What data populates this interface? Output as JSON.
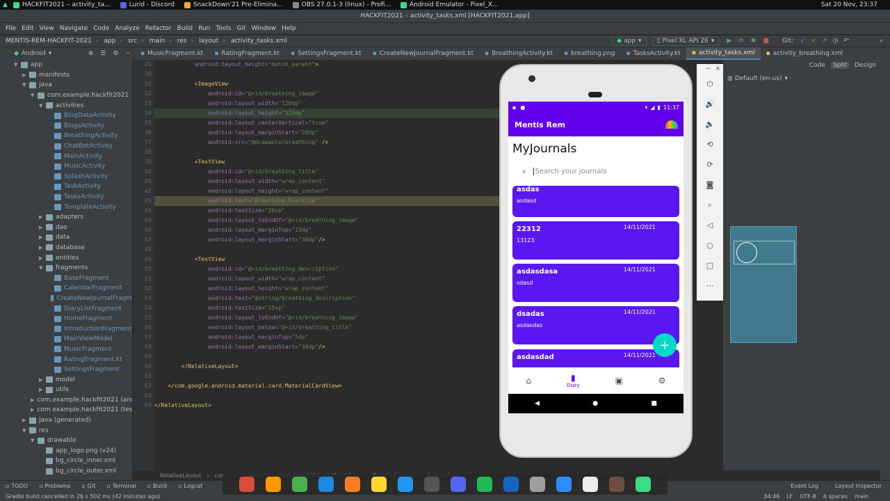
{
  "topbar": {
    "apps": [
      {
        "label": "HACKFIT2021 – activity_ta...",
        "color": "#3ddc84"
      },
      {
        "label": "Lurid - Discord",
        "color": "#5865f2"
      },
      {
        "label": "SnackDown'21 Pre-Elimina...",
        "color": "#f0a830"
      },
      {
        "label": "OBS 27.0.1-3 (linux) - Profi...",
        "color": "#888888"
      },
      {
        "label": "Android Emulator - Pixel_X...",
        "color": "#3ddc84"
      }
    ],
    "datetime": "Sat 20 Nov, 23:37"
  },
  "window_title": "HACKFIT2021 – activity_tasks.xml [HACKFIT2021.app]",
  "menu": [
    "File",
    "Edit",
    "View",
    "Navigate",
    "Code",
    "Analyze",
    "Refactor",
    "Build",
    "Run",
    "Tools",
    "Git",
    "Window",
    "Help"
  ],
  "breadcrumbs": [
    "MENTIS-REM-HACKFIT-2021",
    "app",
    "src",
    "main",
    "res",
    "layout",
    "activity_tasks.xml"
  ],
  "run_config": "app",
  "device": "Pixel XL API 26",
  "git_label": "Git:",
  "project_view": "Android",
  "tabs": [
    {
      "label": "MusicFragment.kt",
      "active": false
    },
    {
      "label": "RatingFragment.kt",
      "active": false
    },
    {
      "label": "SettingsFragment.kt",
      "active": false
    },
    {
      "label": "CreateNewJournalFragment.kt",
      "active": false
    },
    {
      "label": "BreathingActivity.kt",
      "active": false
    },
    {
      "label": "breathing.png",
      "active": false
    },
    {
      "label": "TasksActivity.kt",
      "active": false
    },
    {
      "label": "activity_tasks.xml",
      "active": true
    },
    {
      "label": "activity_breathing.xml",
      "active": false
    }
  ],
  "tree": [
    {
      "label": "app",
      "depth": 0,
      "arrow": "▼",
      "kt": false
    },
    {
      "label": "manifests",
      "depth": 1,
      "arrow": "▶",
      "kt": false
    },
    {
      "label": "java",
      "depth": 1,
      "arrow": "▼",
      "kt": false
    },
    {
      "label": "com.example.hackfit2021",
      "depth": 2,
      "arrow": "▼",
      "kt": false
    },
    {
      "label": "activities",
      "depth": 3,
      "arrow": "▼",
      "kt": false
    },
    {
      "label": "BlogDataActivity",
      "depth": 4,
      "arrow": "",
      "kt": true
    },
    {
      "label": "BlogsActivity",
      "depth": 4,
      "arrow": "",
      "kt": true
    },
    {
      "label": "BreathingActivity",
      "depth": 4,
      "arrow": "",
      "kt": true
    },
    {
      "label": "ChatBotActivity",
      "depth": 4,
      "arrow": "",
      "kt": true
    },
    {
      "label": "MainActivity",
      "depth": 4,
      "arrow": "",
      "kt": true
    },
    {
      "label": "MusicActivity",
      "depth": 4,
      "arrow": "",
      "kt": true
    },
    {
      "label": "SplashActivity",
      "depth": 4,
      "arrow": "",
      "kt": true
    },
    {
      "label": "TaskActivity",
      "depth": 4,
      "arrow": "",
      "kt": true
    },
    {
      "label": "TasksActivity",
      "depth": 4,
      "arrow": "",
      "kt": true
    },
    {
      "label": "TemplateActivity",
      "depth": 4,
      "arrow": "",
      "kt": true
    },
    {
      "label": "adapters",
      "depth": 3,
      "arrow": "▶",
      "kt": false
    },
    {
      "label": "dao",
      "depth": 3,
      "arrow": "▶",
      "kt": false
    },
    {
      "label": "data",
      "depth": 3,
      "arrow": "▶",
      "kt": false
    },
    {
      "label": "database",
      "depth": 3,
      "arrow": "▶",
      "kt": false
    },
    {
      "label": "entities",
      "depth": 3,
      "arrow": "▶",
      "kt": false
    },
    {
      "label": "fragments",
      "depth": 3,
      "arrow": "▼",
      "kt": false
    },
    {
      "label": "BaseFragment",
      "depth": 4,
      "arrow": "",
      "kt": true
    },
    {
      "label": "CalendarFragment",
      "depth": 4,
      "arrow": "",
      "kt": true
    },
    {
      "label": "CreateNewJournalFragm",
      "depth": 4,
      "arrow": "",
      "kt": true
    },
    {
      "label": "DiaryListFragment",
      "depth": 4,
      "arrow": "",
      "kt": true
    },
    {
      "label": "HomeFragment",
      "depth": 4,
      "arrow": "",
      "kt": true
    },
    {
      "label": "IntroductionFragment",
      "depth": 4,
      "arrow": "",
      "kt": true
    },
    {
      "label": "MainViewModel",
      "depth": 4,
      "arrow": "",
      "kt": true
    },
    {
      "label": "MusicFragment",
      "depth": 4,
      "arrow": "",
      "kt": true
    },
    {
      "label": "RatingFragment.kt",
      "depth": 4,
      "arrow": "",
      "kt": true
    },
    {
      "label": "SettingsFragment",
      "depth": 4,
      "arrow": "",
      "kt": true
    },
    {
      "label": "model",
      "depth": 3,
      "arrow": "▶",
      "kt": false
    },
    {
      "label": "utils",
      "depth": 3,
      "arrow": "▶",
      "kt": false
    },
    {
      "label": "com.example.hackfit2021 (and",
      "depth": 2,
      "arrow": "▶",
      "kt": false
    },
    {
      "label": "com.example.hackfit2021 (test",
      "depth": 2,
      "arrow": "▶",
      "kt": false
    },
    {
      "label": "java (generated)",
      "depth": 1,
      "arrow": "▶",
      "kt": false
    },
    {
      "label": "res",
      "depth": 1,
      "arrow": "▼",
      "kt": false
    },
    {
      "label": "drawable",
      "depth": 2,
      "arrow": "▼",
      "kt": false
    },
    {
      "label": "app_logo.png (v24)",
      "depth": 3,
      "arrow": "",
      "kt": false
    },
    {
      "label": "bg_circle_inner.xml",
      "depth": 3,
      "arrow": "",
      "kt": false
    },
    {
      "label": "bg_circle_outer.xml",
      "depth": 3,
      "arrow": "",
      "kt": false
    }
  ],
  "line_numbers": [
    "29",
    "30",
    "31",
    "32",
    "33",
    "34",
    "35",
    "36",
    "37",
    "38",
    "39",
    "40",
    "41",
    "42",
    "43",
    "44",
    "45",
    "46",
    "47",
    "48",
    "49",
    "50",
    "51",
    "52",
    "53",
    "54",
    "55",
    "56",
    "57",
    "58",
    "59",
    "60",
    "61",
    "62",
    "63",
    "64"
  ],
  "code_lines": [
    "            android:layout_height=\"match_parent\">",
    "",
    "            <ImageView",
    "                android:id=\"@+id/breathing_image\"",
    "                android:layout_width=\"120dp\"",
    "                android:layout_height=\"120dp\"",
    "                android:layout_centerVertical=\"true\"",
    "                android:layout_marginStart=\"20dp\"",
    "                android:src=\"@drawable/breathing\" />",
    "",
    "            <TextView",
    "                android:id=\"@+id/breathing_title\"",
    "                android:layout_width=\"wrap_content\"",
    "                android:layout_height=\"wrap_content\"",
    "                android:text=\"Breathing Exercise\"",
    "                android:textSize=\"20sp\"",
    "                android:layout_toEndOf=\"@+id/breathing_image\"",
    "                android:layout_marginTop=\"15dp\"",
    "                android:layout_marginStart=\"30dp\"/>",
    "",
    "            <TextView",
    "                android:id=\"@+id/breathing_description\"",
    "                android:layout_width=\"wrap_content\"",
    "                android:layout_height=\"wrap_content\"",
    "                android:text=\"@string/breathing_description\"",
    "                android:textSize=\"15sp\"",
    "                android:layout_toEndOf=\"@+id/breathing_image\"",
    "                android:layout_below=\"@+id/breathing_title\"",
    "                android:layout_marginTop=\"5dp\"",
    "                android:layout_marginStart=\"30dp\"/>",
    "",
    "        </RelativeLayout>",
    "",
    "    </com.google.android.material.card.MaterialCardView>",
    "",
    "</RelativeLayout>"
  ],
  "bottom_breadcrumb": [
    "RelativeLayout",
    "com.google.android.material.card.MaterialCardView",
    "RelativeLayout",
    "ImageView"
  ],
  "design_modes": [
    "Code",
    "Split",
    "Design"
  ],
  "locale": "Default (en-us)",
  "phone": {
    "time": "11:37",
    "app_title": "Mentis Rem",
    "heading": "MyJournals",
    "search_placeholder": "Search your journals",
    "journals": [
      {
        "title": "asdas",
        "body": "asdasd",
        "date": ""
      },
      {
        "title": "22312",
        "body": "13123",
        "date": "14/11/2021"
      },
      {
        "title": "asdasdasa",
        "body": "sdasd",
        "date": "14/11/2021"
      },
      {
        "title": "dsadas",
        "body": "asdasdas",
        "date": "14/11/2021"
      },
      {
        "title": "asdasdad",
        "body": "",
        "date": "14/11/2021"
      }
    ],
    "fab": "+",
    "nav": [
      {
        "icon": "home-icon",
        "glyph": "⌂",
        "label": ""
      },
      {
        "icon": "diary-icon",
        "glyph": "▮",
        "label": "Diary"
      },
      {
        "icon": "library-icon",
        "glyph": "▣",
        "label": ""
      },
      {
        "icon": "settings-icon",
        "glyph": "⚙",
        "label": ""
      }
    ]
  },
  "tool_windows": [
    "TODO",
    "Problems",
    "Git",
    "Terminal",
    "Build",
    "Logcat"
  ],
  "right_tools": [
    "Event Log",
    "Layout Inspector"
  ],
  "status_message": "Gradle build cancelled in 26 s 502 ms (42 minutes ago)",
  "status_right": [
    "34:46",
    "LF",
    "UTF-8",
    "4 spaces",
    "main"
  ],
  "dock_apps": [
    {
      "icon": "todoist-icon",
      "color": "#db4c3f"
    },
    {
      "icon": "sublime-icon",
      "color": "#ff9800"
    },
    {
      "icon": "chrome-icon",
      "color": "#4caf50"
    },
    {
      "icon": "vscode-icon",
      "color": "#1e88e5"
    },
    {
      "icon": "xampp-icon",
      "color": "#fb7a24"
    },
    {
      "icon": "notes-icon",
      "color": "#fdd835"
    },
    {
      "icon": "paint-icon",
      "color": "#2196f3"
    },
    {
      "icon": "obs-icon",
      "color": "#555555"
    },
    {
      "icon": "discord-icon",
      "color": "#5865f2"
    },
    {
      "icon": "spotify-icon",
      "color": "#1db954"
    },
    {
      "icon": "audacity-icon",
      "color": "#1565c0"
    },
    {
      "icon": "files-icon",
      "color": "#9e9e9e"
    },
    {
      "icon": "zoom-icon",
      "color": "#2d8cff"
    },
    {
      "icon": "doc-icon",
      "color": "#eeeeee"
    },
    {
      "icon": "gimp-icon",
      "color": "#6d4c41"
    },
    {
      "icon": "android-studio-icon",
      "color": "#3ddc84"
    }
  ],
  "colors": {
    "accent": "#6200ee",
    "card": "#5b17f2",
    "fab": "#03dac5",
    "ide_bg": "#2b2b2b",
    "panel": "#3c3f41"
  }
}
